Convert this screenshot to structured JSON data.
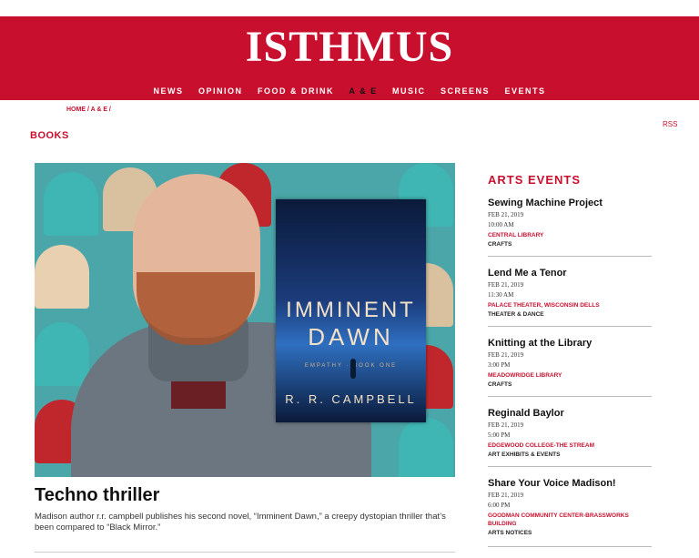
{
  "site": {
    "logo": "ISTHMUS"
  },
  "nav": {
    "items": [
      "NEWS",
      "OPINION",
      "FOOD & DRINK",
      "A & E",
      "MUSIC",
      "SCREENS",
      "EVENTS"
    ],
    "active": "A & E"
  },
  "breadcrumb": "HOME / A & E /",
  "section_title": "BOOKS",
  "rss": "RSS",
  "book_cover": {
    "title_line1": "IMMINENT",
    "title_line2": "DAWN",
    "series": "EMPATHY · BOOK ONE",
    "author": "R. R. CAMPBELL"
  },
  "article": {
    "headline": "Techno thriller",
    "dek": "Madison author r.r. campbell publishes his second novel, “Imminent Dawn,” a creepy dystopian thriller that’s been compared to “Black Mirror.”"
  },
  "events": {
    "title": "ARTS EVENTS",
    "items": [
      {
        "name": "Sewing Machine Project",
        "date": "FEB 21, 2019",
        "time": "10:00 AM",
        "venue": "CENTRAL LIBRARY",
        "category": "CRAFTS"
      },
      {
        "name": "Lend Me a Tenor",
        "date": "FEB 21, 2019",
        "time": "11:30 AM",
        "venue": "PALACE THEATER, WISCONSIN DELLS",
        "category": "THEATER & DANCE"
      },
      {
        "name": "Knitting at the Library",
        "date": "FEB 21, 2019",
        "time": "3:00 PM",
        "venue": "MEADOWRIDGE LIBRARY",
        "category": "CRAFTS"
      },
      {
        "name": "Reginald Baylor",
        "date": "FEB 21, 2019",
        "time": "5:00 PM",
        "venue": "EDGEWOOD COLLEGE-THE STREAM",
        "category": "ART EXHIBITS & EVENTS"
      },
      {
        "name": "Share Your Voice Madison!",
        "date": "FEB 21, 2019",
        "time": "6:00 PM",
        "venue": "GOODMAN COMMUNITY CENTER-BRASSWORKS BUILDING",
        "category": "ARTS NOTICES"
      }
    ]
  },
  "colors": {
    "brand_red": "#c8102e"
  }
}
